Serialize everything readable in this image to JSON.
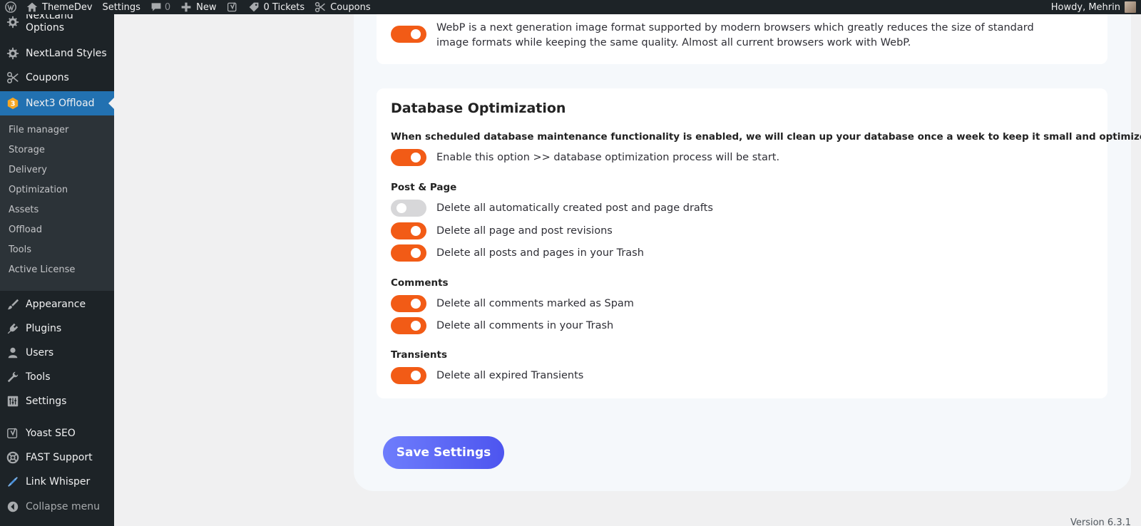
{
  "admin_bar": {
    "site_name": "ThemeDev",
    "settings": "Settings",
    "comments_count": "0",
    "new": "New",
    "tickets": "0 Tickets",
    "coupons": "Coupons",
    "greeting": "Howdy, Mehrin"
  },
  "sidebar": {
    "items": [
      {
        "label": "NextLand Options",
        "icon": "gear-icon"
      },
      {
        "label": "NextLand Styles",
        "icon": "gear-icon"
      },
      {
        "label": "Coupons",
        "icon": "scissors-icon"
      },
      {
        "label": "Next3 Offload",
        "icon": "next3-logo-icon"
      },
      {
        "label": "Appearance",
        "icon": "paintbrush-icon"
      },
      {
        "label": "Plugins",
        "icon": "plugin-icon"
      },
      {
        "label": "Users",
        "icon": "users-icon"
      },
      {
        "label": "Tools",
        "icon": "wrench-icon"
      },
      {
        "label": "Settings",
        "icon": "settings-sliders-icon"
      },
      {
        "label": "Yoast SEO",
        "icon": "yoast-icon"
      },
      {
        "label": "FAST Support",
        "icon": "support-icon"
      },
      {
        "label": "Link Whisper",
        "icon": "link-icon"
      }
    ],
    "submenu": [
      "File manager",
      "Storage",
      "Delivery",
      "Optimization",
      "Assets",
      "Offload",
      "Tools",
      "Active License"
    ],
    "collapse": "Collapse menu"
  },
  "webp": {
    "description": "WebP is a next generation image format supported by modern browsers which greatly reduces the size of standard image formats while keeping the same quality. Almost all current browsers work with WebP.",
    "enabled": true
  },
  "database": {
    "title": "Database Optimization",
    "description": "When scheduled database maintenance functionality is enabled, we will clean up your database once a week to keep it small and optimized.",
    "enable_label": "Enable this option >> database optimization process will be start.",
    "enable_on": true,
    "groups": [
      {
        "title": "Post & Page",
        "options": [
          {
            "label": "Delete all automatically created post and page drafts",
            "on": false
          },
          {
            "label": "Delete all page and post revisions",
            "on": true
          },
          {
            "label": "Delete all posts and pages in your Trash",
            "on": true
          }
        ]
      },
      {
        "title": "Comments",
        "options": [
          {
            "label": "Delete all comments marked as Spam",
            "on": true
          },
          {
            "label": "Delete all comments in your Trash",
            "on": true
          }
        ]
      },
      {
        "title": "Transients",
        "options": [
          {
            "label": "Delete all expired Transients",
            "on": true
          }
        ]
      }
    ]
  },
  "save_label": "Save Settings",
  "version": "Version 6.3.1",
  "colors": {
    "toggle_on": "#f25b16",
    "toggle_off": "#d7d7d9",
    "save_gradient_start": "#6e7dfc",
    "save_gradient_end": "#4d55ef",
    "active_menu": "#2271b1"
  }
}
